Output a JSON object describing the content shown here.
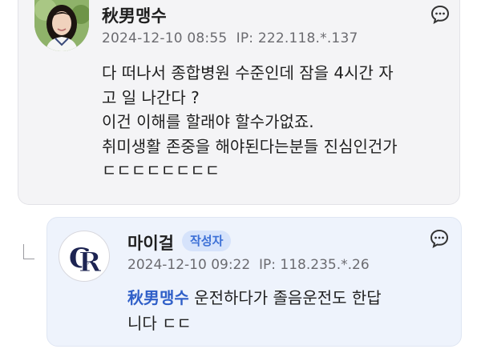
{
  "comment": {
    "author": "秋男맹수",
    "date": "2024-12-10 08:55",
    "ip": "IP: 222.118.*.137",
    "body_lines": [
      "다 떠나서 종합병원 수준인데 잠을 4시간 자",
      "고 일 나간다 ?",
      "이건 이해를 할래야 할수가없죠.",
      "취미생활 존중을 해야된다는분들 진심인건가",
      "ㄷㄷㄷㄷㄷㄷㄷㄷ"
    ],
    "reply_icon": "comment-reply-icon"
  },
  "reply": {
    "author": "마이걸",
    "badge": "작성자",
    "date": "2024-12-10 09:22",
    "ip": "IP: 118.235.*.26",
    "mention": "秋男맹수",
    "body_first": " 운전하다가 졸음운전도 한답",
    "body_second": "니다 ㄷㄷ",
    "reply_icon": "comment-reply-icon",
    "avatar_logo": "CR"
  },
  "colors": {
    "card_bg": "#f4f4f6",
    "reply_bg": "#eef3fc",
    "badge_text": "#3b6fd6",
    "badge_bg": "#d6e3fb",
    "mention": "#2f5fc8",
    "meta_text": "#6b6b70"
  }
}
